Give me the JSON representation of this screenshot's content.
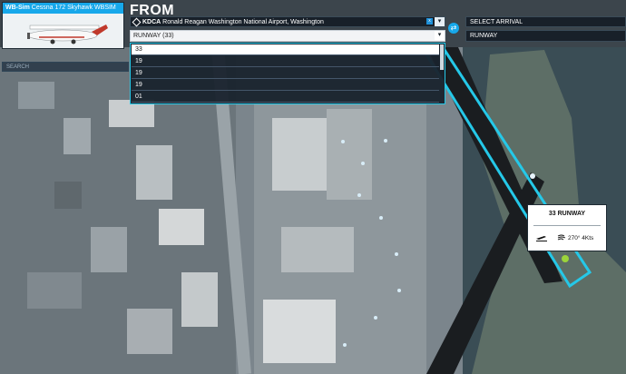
{
  "aircraft": {
    "title_bold": "WB-Sim",
    "title_rest": " Cessna 172 Skyhawk WBSIM"
  },
  "search": {
    "placeholder": "SEARCH"
  },
  "from": {
    "title": "FROM",
    "airport_code": "KDCA",
    "airport_name": " Ronald Reagan Washington National Airport, Washington",
    "clear_label": "x",
    "runway_value": "RUNWAY (33)"
  },
  "runway_options": [
    "33",
    "19",
    "19",
    "19",
    "01"
  ],
  "arrival": {
    "airport_placeholder": "SELECT ARRIVAL",
    "runway_placeholder": "RUNWAY"
  },
  "runway_card": {
    "title": "33 RUNWAY",
    "wind": "270° 4Kts"
  },
  "icons": [
    "diamond-icon",
    "chevron-down-icon",
    "swap-icon",
    "takeoff-icon",
    "wind-icon"
  ],
  "colors": {
    "accent": "#17a8ea",
    "runway_highlight": "#25c8e8",
    "start_marker": "#9bd43a"
  }
}
